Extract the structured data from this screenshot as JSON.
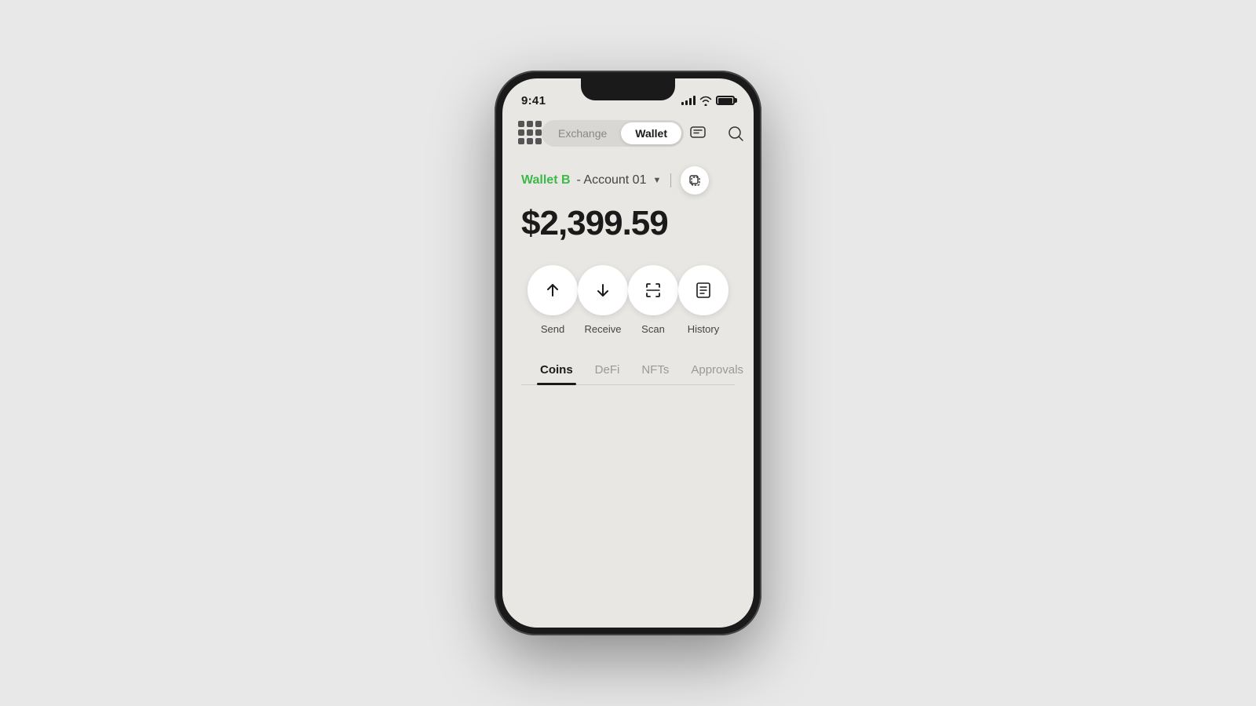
{
  "status": {
    "time": "9:41",
    "signal_bars": [
      4,
      6,
      8,
      10,
      12
    ],
    "battery_label": "battery"
  },
  "nav": {
    "exchange_label": "Exchange",
    "wallet_label": "Wallet",
    "active_tab": "wallet",
    "grid_icon": "grid-icon",
    "message_icon": "message-icon",
    "search_icon": "search-icon"
  },
  "account": {
    "wallet_name": "Wallet B",
    "account_label": "- Account 01",
    "copy_icon": "copy-icon"
  },
  "balance": {
    "amount": "$2,399.59"
  },
  "actions": [
    {
      "id": "send",
      "label": "Send",
      "icon": "arrow-up-icon"
    },
    {
      "id": "receive",
      "label": "Receive",
      "icon": "arrow-down-icon"
    },
    {
      "id": "scan",
      "label": "Scan",
      "icon": "scan-icon"
    },
    {
      "id": "history",
      "label": "History",
      "icon": "history-icon"
    }
  ],
  "content_tabs": [
    {
      "id": "coins",
      "label": "Coins",
      "active": true
    },
    {
      "id": "defi",
      "label": "DeFi",
      "active": false
    },
    {
      "id": "nfts",
      "label": "NFTs",
      "active": false
    },
    {
      "id": "approvals",
      "label": "Approvals",
      "active": false
    }
  ]
}
